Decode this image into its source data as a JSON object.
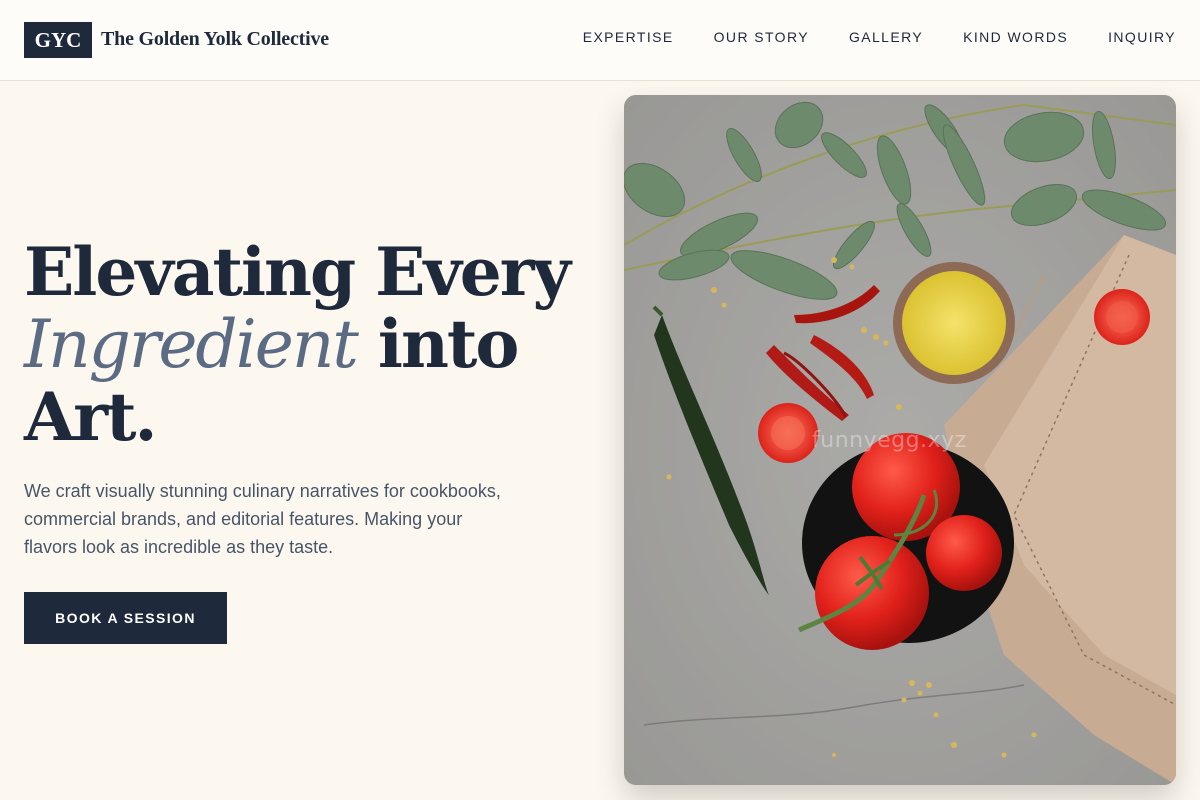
{
  "brand": {
    "badge": "GYC",
    "name": "The Golden Yolk Collective"
  },
  "nav": {
    "items": [
      "EXPERTISE",
      "OUR STORY",
      "GALLERY",
      "KIND WORDS",
      "INQUIRY"
    ]
  },
  "hero": {
    "headline_line1": "Elevating Every",
    "headline_italic": "Ingredient",
    "headline_line2_rest": " into",
    "headline_line3": "Art.",
    "lead": "We craft visually stunning culinary narratives for cookbooks, commercial brands, and editorial features. Making your flavors look as incredible as they taste.",
    "cta": "BOOK A SESSION"
  },
  "photo": {
    "watermark": "funnyegg.xyz",
    "subject": "food-flatlay-image"
  },
  "colors": {
    "navy": "#1e293b",
    "cream": "#fdf8ef",
    "slate_italic": "#5b6b84",
    "body_text": "#475569"
  }
}
